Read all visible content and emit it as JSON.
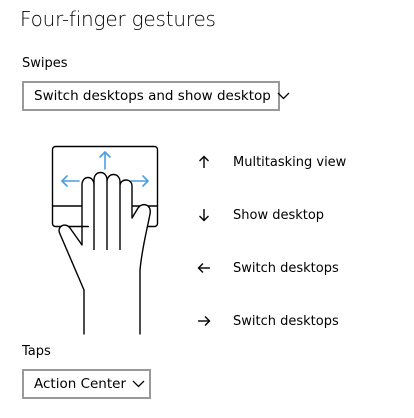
{
  "page": {
    "title": "Four-finger gestures"
  },
  "swipes": {
    "label": "Swipes",
    "selected": "Switch desktops and show desktop"
  },
  "legend": [
    {
      "icon": "arrow-up-icon",
      "label": "Multitasking view"
    },
    {
      "icon": "arrow-down-icon",
      "label": "Show desktop"
    },
    {
      "icon": "arrow-left-icon",
      "label": "Switch desktops"
    },
    {
      "icon": "arrow-right-icon",
      "label": "Switch desktops"
    }
  ],
  "taps": {
    "label": "Taps",
    "selected": "Action Center"
  },
  "colors": {
    "accent_arrows": "#4a9fe0",
    "outline": "#000000",
    "dropdown_border": "#999999"
  }
}
